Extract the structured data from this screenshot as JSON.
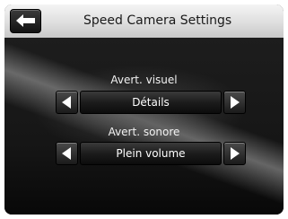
{
  "header": {
    "title": "Speed Camera Settings",
    "back_icon": "back-arrow-icon"
  },
  "settings": [
    {
      "label": "Avert. visuel",
      "value": "Détails",
      "prev_icon": "left-arrow-icon",
      "next_icon": "right-arrow-icon"
    },
    {
      "label": "Avert. sonore",
      "value": "Plein volume",
      "prev_icon": "left-arrow-icon",
      "next_icon": "right-arrow-icon"
    }
  ],
  "colors": {
    "header_bg": "#dedede",
    "screen_bg": "#161616",
    "text_light": "#f2f2f2"
  }
}
